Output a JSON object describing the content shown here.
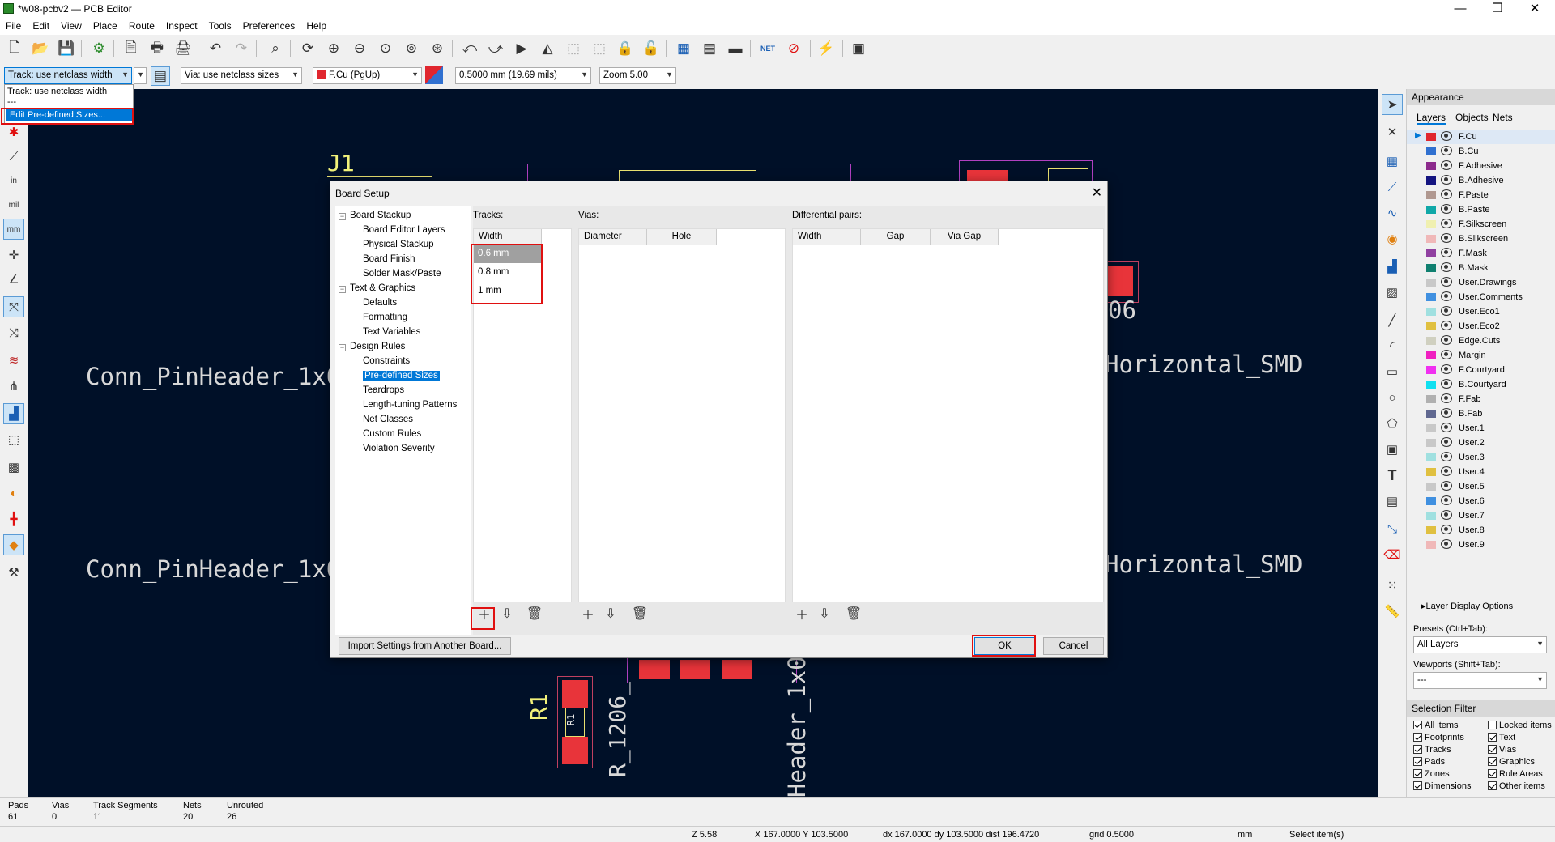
{
  "window": {
    "title": "*w08-pcbv2 — PCB Editor",
    "minimize": "—",
    "restore": "❐",
    "close": "✕"
  },
  "menu": [
    "File",
    "Edit",
    "View",
    "Place",
    "Route",
    "Inspect",
    "Tools",
    "Preferences",
    "Help"
  ],
  "toolbar2": {
    "track_width": "Track: use netclass width",
    "via_size": "Via: use netclass sizes",
    "layer": "F.Cu (PgUp)",
    "grid": "0.5000 mm (19.69 mils)",
    "zoom": "Zoom 5.00"
  },
  "track_dropdown": {
    "item1": "Track: use netclass width",
    "item2": "---",
    "item3": "Edit Pre-defined Sizes..."
  },
  "canvas": {
    "j1": "J1",
    "conn1": "Conn_PinHeader_1x0",
    "conn2": "Conn_PinHeader_1x0",
    "horiz1": "Horizontal_SMD",
    "horiz2": "Horizontal_SMD",
    "ref06": "06",
    "r1": "R1",
    "r1206": "R_1206_",
    "header": "Header_1x0",
    "r1_pad_label": "R1"
  },
  "dialog": {
    "title": "Board Setup",
    "close": "✕",
    "tree": [
      {
        "label": "Board Stackup",
        "level": 0
      },
      {
        "label": "Board Editor Layers",
        "level": 1
      },
      {
        "label": "Physical Stackup",
        "level": 1
      },
      {
        "label": "Board Finish",
        "level": 1
      },
      {
        "label": "Solder Mask/Paste",
        "level": 1
      },
      {
        "label": "Text & Graphics",
        "level": 0
      },
      {
        "label": "Defaults",
        "level": 1
      },
      {
        "label": "Formatting",
        "level": 1
      },
      {
        "label": "Text Variables",
        "level": 1
      },
      {
        "label": "Design Rules",
        "level": 0
      },
      {
        "label": "Constraints",
        "level": 1
      },
      {
        "label": "Pre-defined Sizes",
        "level": 1,
        "selected": true
      },
      {
        "label": "Teardrops",
        "level": 1
      },
      {
        "label": "Length-tuning Patterns",
        "level": 1
      },
      {
        "label": "Net Classes",
        "level": 1
      },
      {
        "label": "Custom Rules",
        "level": 1
      },
      {
        "label": "Violation Severity",
        "level": 1
      }
    ],
    "tracks_label": "Tracks:",
    "tracks_header": "Width",
    "tracks": [
      "0.6 mm",
      "0.8 mm",
      "1 mm"
    ],
    "vias_label": "Vias:",
    "vias_headers": [
      "Diameter",
      "Hole"
    ],
    "diff_label": "Differential pairs:",
    "diff_headers": [
      "Width",
      "Gap",
      "Via Gap"
    ],
    "import_button": "Import Settings from Another Board...",
    "ok": "OK",
    "cancel": "Cancel"
  },
  "appearance": {
    "title": "Appearance",
    "tabs": [
      "Layers",
      "Objects",
      "Nets"
    ],
    "layers": [
      {
        "name": "F.Cu",
        "color": "#e0262e"
      },
      {
        "name": "B.Cu",
        "color": "#3070d0"
      },
      {
        "name": "F.Adhesive",
        "color": "#8c2a8c"
      },
      {
        "name": "B.Adhesive",
        "color": "#141480"
      },
      {
        "name": "F.Paste",
        "color": "#b09890"
      },
      {
        "name": "B.Paste",
        "color": "#10a8a8"
      },
      {
        "name": "F.Silkscreen",
        "color": "#f0f0b0"
      },
      {
        "name": "B.Silkscreen",
        "color": "#f0b8b8"
      },
      {
        "name": "F.Mask",
        "color": "#9040a0"
      },
      {
        "name": "B.Mask",
        "color": "#108070"
      },
      {
        "name": "User.Drawings",
        "color": "#c8c8c8"
      },
      {
        "name": "User.Comments",
        "color": "#4090e0"
      },
      {
        "name": "User.Eco1",
        "color": "#a0e0e0"
      },
      {
        "name": "User.Eco2",
        "color": "#e0c040"
      },
      {
        "name": "Edge.Cuts",
        "color": "#d0d0c0"
      },
      {
        "name": "Margin",
        "color": "#f020c0"
      },
      {
        "name": "F.Courtyard",
        "color": "#f030f0"
      },
      {
        "name": "B.Courtyard",
        "color": "#10e0f0"
      },
      {
        "name": "F.Fab",
        "color": "#b0b0b0"
      },
      {
        "name": "B.Fab",
        "color": "#606890"
      },
      {
        "name": "User.1",
        "color": "#c8c8c8"
      },
      {
        "name": "User.2",
        "color": "#c8c8c8"
      },
      {
        "name": "User.3",
        "color": "#a0e0e0"
      },
      {
        "name": "User.4",
        "color": "#e0c040"
      },
      {
        "name": "User.5",
        "color": "#c8c8c8"
      },
      {
        "name": "User.6",
        "color": "#4090e0"
      },
      {
        "name": "User.7",
        "color": "#a0e0e0"
      },
      {
        "name": "User.8",
        "color": "#e0c040"
      },
      {
        "name": "User.9",
        "color": "#f0b8b8"
      }
    ],
    "layer_display_options": "Layer Display Options",
    "presets_label": "Presets (Ctrl+Tab):",
    "presets_value": "All Layers",
    "viewports_label": "Viewports (Shift+Tab):",
    "viewports_value": "---",
    "selection_filter_title": "Selection Filter",
    "selection_filter": [
      {
        "label": "All items",
        "checked": true
      },
      {
        "label": "Locked items",
        "checked": false
      },
      {
        "label": "Footprints",
        "checked": true
      },
      {
        "label": "Text",
        "checked": true
      },
      {
        "label": "Tracks",
        "checked": true
      },
      {
        "label": "Vias",
        "checked": true
      },
      {
        "label": "Pads",
        "checked": true
      },
      {
        "label": "Graphics",
        "checked": true
      },
      {
        "label": "Zones",
        "checked": true
      },
      {
        "label": "Rule Areas",
        "checked": true
      },
      {
        "label": "Dimensions",
        "checked": true
      },
      {
        "label": "Other items",
        "checked": true
      }
    ]
  },
  "status": {
    "pads_label": "Pads",
    "pads": "61",
    "vias_label": "Vias",
    "vias": "0",
    "tracks_label": "Track Segments",
    "tracks": "11",
    "nets_label": "Nets",
    "nets": "20",
    "unrouted_label": "Unrouted",
    "unrouted": "26",
    "z": "Z 5.58",
    "xy": "X 167.0000  Y 103.5000",
    "dxy": "dx 167.0000  dy 103.5000  dist 196.4720",
    "grid": "grid 0.5000",
    "units": "mm",
    "mode": "Select item(s)"
  }
}
